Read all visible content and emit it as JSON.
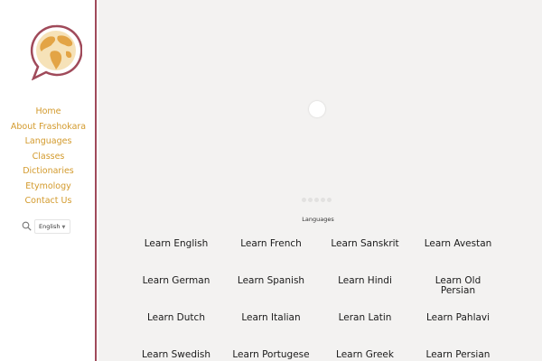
{
  "sidebar": {
    "nav": [
      "Home",
      "About Frashokara",
      "Languages",
      "Classes",
      "Dictionaries",
      "Etymology",
      "Contact Us"
    ],
    "language_select": "English"
  },
  "main": {
    "section_title": "Languages",
    "languages": [
      "Learn English",
      "Learn French",
      "Learn Sanskrit",
      "Learn Avestan",
      "Learn German",
      "Learn Spanish",
      "Learn Hindi",
      "Learn Old Persian",
      "Learn Dutch",
      "Learn Italian",
      "Leran Latin",
      "Learn Pahlavi",
      "Learn Swedish",
      "Learn Portugese",
      "Learn Greek",
      "Learn Persian"
    ]
  },
  "colors": {
    "accent": "#d39a2c",
    "brand": "#a04a5a",
    "background": "#f3f2f1"
  },
  "icons": [
    "globe-speech-logo",
    "search-icon",
    "chevron-down-icon"
  ]
}
